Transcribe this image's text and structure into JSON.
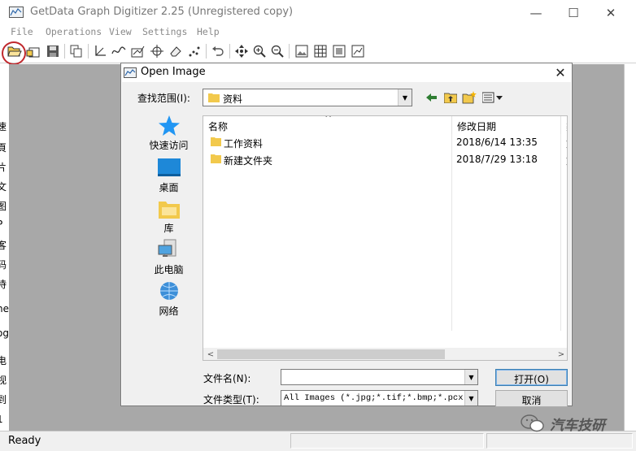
{
  "app": {
    "title": "GetData Graph Digitizer 2.25 (Unregistered copy)",
    "menu": [
      "File",
      "Operations",
      "View",
      "Settings",
      "Help"
    ],
    "toolbar_icons": [
      "open-file-icon",
      "open-image-icon",
      "save-icon",
      "copy-icon",
      "axes-icon",
      "line-icon",
      "digitize-icon",
      "point-icon",
      "eraser-icon",
      "grid-points-icon",
      "undo-icon",
      "pan-icon",
      "zoom-in-icon",
      "zoom-out-icon",
      "image-icon",
      "grid-icon",
      "fit-icon",
      "graph-icon"
    ],
    "left_edge_fragments": [
      "速",
      "頁",
      "片",
      "文",
      "图",
      "P",
      "客",
      "码",
      "待",
      "ne",
      "og",
      "电",
      "视",
      "到",
      "1"
    ],
    "status": "Ready"
  },
  "dialog": {
    "title": "Open Image",
    "look_in_label": "查找范围(I):",
    "look_in_value": "资料",
    "places": [
      "快速访问",
      "桌面",
      "库",
      "此电脑",
      "网络"
    ],
    "columns": [
      "名称",
      "修改日期",
      "类"
    ],
    "files": [
      {
        "name": "工作资料",
        "date": "2018/6/14 13:35",
        "type": "文"
      },
      {
        "name": "新建文件夹",
        "date": "2018/7/29 13:18",
        "type": "文"
      }
    ],
    "filename_label": "文件名(N):",
    "filename_value": "",
    "filetype_label": "文件类型(T):",
    "filetype_value": "All Images (*.jpg;*.tif;*.bmp;*.pcx)",
    "open_label": "打开(O)",
    "cancel_label": "取消"
  },
  "watermark": "汽车技研",
  "colors": {
    "highlight_circle": "#c0282d",
    "workspace": "#a8a8a8",
    "folder": "#f2c94c",
    "desktop": "#1e88d8"
  }
}
